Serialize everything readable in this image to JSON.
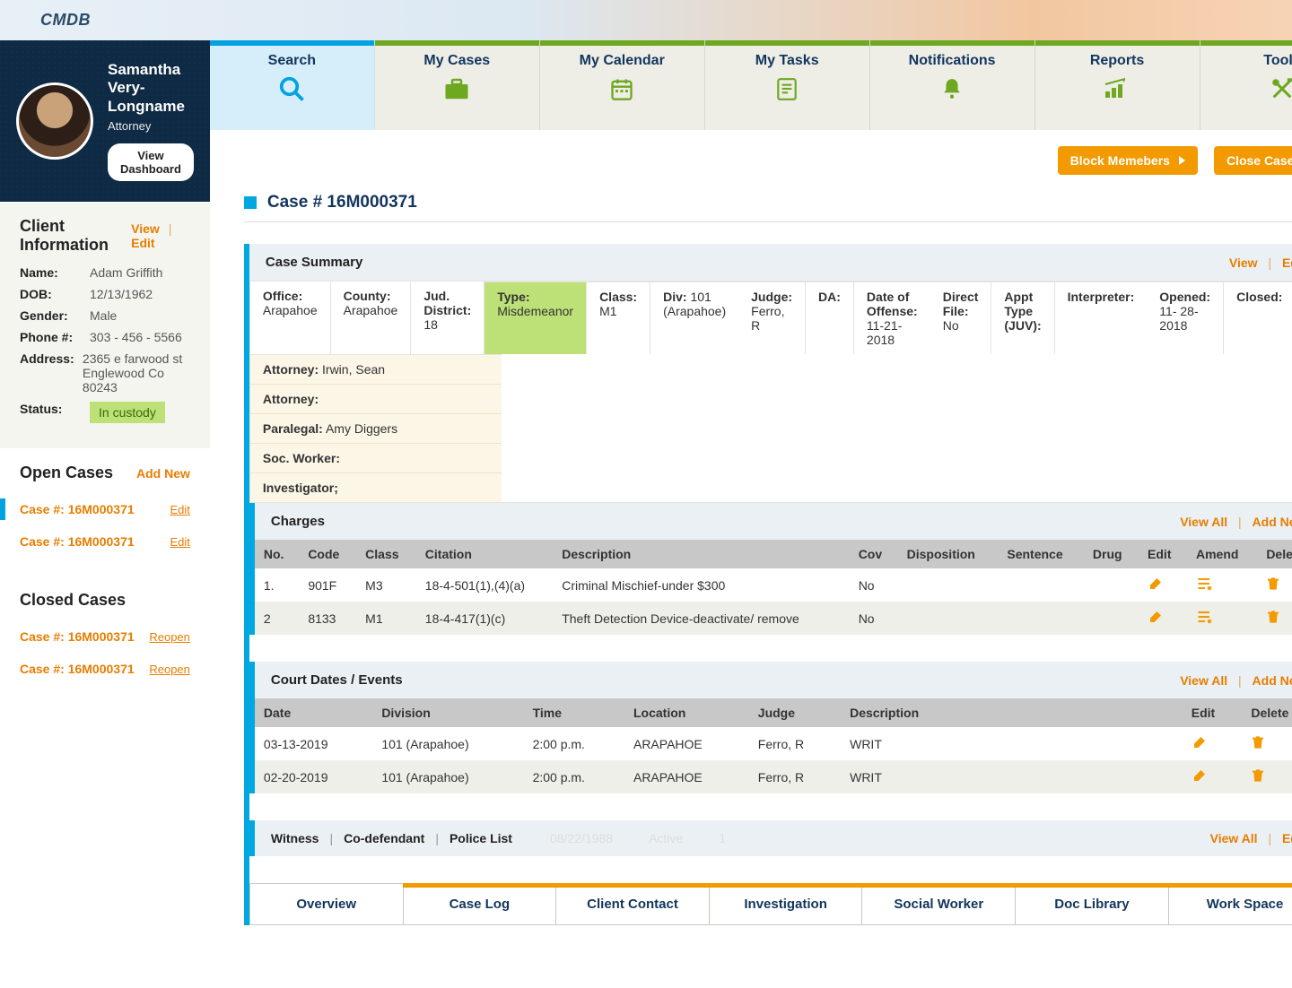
{
  "brand": "CMDB",
  "user": {
    "name_line1": "Samantha",
    "name_line2": "Very-Longname",
    "role": "Attorney",
    "dashboard_btn": "View Dashboard"
  },
  "topnav": [
    {
      "label": "Search",
      "icon": "search-icon",
      "active": true
    },
    {
      "label": "My Cases",
      "icon": "briefcase-icon"
    },
    {
      "label": "My Calendar",
      "icon": "calendar-icon"
    },
    {
      "label": "My Tasks",
      "icon": "tasks-icon"
    },
    {
      "label": "Notifications",
      "icon": "bell-icon"
    },
    {
      "label": "Reports",
      "icon": "reports-icon"
    },
    {
      "label": "Tools",
      "icon": "tools-icon"
    }
  ],
  "action_buttons": {
    "block": "Block Memebers",
    "close": "Close Case"
  },
  "case_header": "Case # 16M000371",
  "client_info": {
    "heading": "Client Information",
    "view": "View",
    "edit": "Edit",
    "name_label": "Name:",
    "name": "Adam Griffith",
    "dob_label": "DOB:",
    "dob": "12/13/1962",
    "gender_label": "Gender:",
    "gender": "Male",
    "phone_label": "Phone #:",
    "phone": "303 - 456 - 5566",
    "address_label": "Address:",
    "address_line1": "2365 e farwood st",
    "address_line2": "Englewood Co 80243",
    "status_label": "Status:",
    "status": "In custody"
  },
  "open_cases": {
    "heading": "Open Cases",
    "add_new": "Add New",
    "items": [
      {
        "label": "Case #: 16M000371",
        "action": "Edit"
      },
      {
        "label": "Case #: 16M000371",
        "action": "Edit"
      }
    ]
  },
  "closed_cases": {
    "heading": "Closed Cases",
    "items": [
      {
        "label": "Case #: 16M000371",
        "action": "Reopen"
      },
      {
        "label": "Case #: 16M000371",
        "action": "Reopen"
      }
    ]
  },
  "summary": {
    "heading": "Case Summary",
    "view": "View",
    "edit": "Edit",
    "rows": [
      [
        {
          "label": "Office:",
          "value": "Arapahoe"
        },
        {
          "label": "County:",
          "value": "Arapahoe"
        },
        {
          "label": "Jud. District:",
          "value": "18"
        }
      ],
      [
        {
          "label": "Type:",
          "value": "Misdemeanor"
        },
        {
          "label": "Class:",
          "value": "M1"
        },
        {
          "label": "Div:",
          "value": "101 (Arapahoe)"
        }
      ],
      [
        {
          "label": "Judge:",
          "value": "Ferro, R"
        },
        {
          "label": "DA:",
          "value": ""
        },
        {
          "label": "Date of Offense:",
          "value": "11-21-2018"
        }
      ],
      [
        {
          "label": "Direct File:",
          "value": "No"
        },
        {
          "label": "Appt Type (JUV):",
          "value": ""
        },
        {
          "label": "Interpreter:",
          "value": ""
        }
      ],
      [
        {
          "label": "Opened:",
          "value": "11- 28- 2018"
        },
        {
          "label": "Closed:",
          "value": ""
        },
        {
          "label": "",
          "value": ""
        }
      ]
    ],
    "right": [
      {
        "label": "Attorney:",
        "value": "Irwin, Sean"
      },
      {
        "label": "Attorney:",
        "value": ""
      },
      {
        "label": "Paralegal:",
        "value": "Amy Diggers"
      },
      {
        "label": "Soc. Worker:",
        "value": ""
      },
      {
        "label": "Investigator;",
        "value": ""
      }
    ]
  },
  "charges": {
    "heading": "Charges",
    "view_all": "View All",
    "add_new": "Add New",
    "columns": [
      "No.",
      "Code",
      "Class",
      "Citation",
      "Description",
      "Cov",
      "Disposition",
      "Sentence",
      "Drug",
      "Edit",
      "Amend",
      "Delete"
    ],
    "rows": [
      {
        "no": "1.",
        "code": "901F",
        "class": "M3",
        "citation": "18-4-501(1),(4)(a)",
        "desc": "Criminal Mischief-under $300",
        "cov": "No"
      },
      {
        "no": "2",
        "code": "8133",
        "class": "M1",
        "citation": "18-4-417(1)(c)",
        "desc": "Theft Detection Device-deactivate/ remove",
        "cov": "No"
      }
    ]
  },
  "court": {
    "heading": "Court Dates / Events",
    "view_all": "View All",
    "add_new": "Add New",
    "columns": [
      "Date",
      "Division",
      "Time",
      "Location",
      "Judge",
      "Description",
      "Edit",
      "Delete"
    ],
    "rows": [
      {
        "date": "03-13-2019",
        "div": "101 (Arapahoe)",
        "time": "2:00 p.m.",
        "loc": "ARAPAHOE",
        "judge": "Ferro, R",
        "desc": "WRIT"
      },
      {
        "date": "02-20-2019",
        "div": "101 (Arapahoe)",
        "time": "2:00 p.m.",
        "loc": "ARAPAHOE",
        "judge": "Ferro, R",
        "desc": "WRIT"
      }
    ]
  },
  "witness": {
    "tabs": [
      "Witness",
      "Co-defendant",
      "Police List"
    ],
    "ghost": [
      "08/22/1988",
      "Active",
      "1"
    ],
    "view_all": "View All",
    "edit": "Edit"
  },
  "bottom_tabs": [
    "Overview",
    "Case Log",
    "Client Contact",
    "Investigation",
    "Social Worker",
    "Doc Library",
    "Work Space"
  ]
}
